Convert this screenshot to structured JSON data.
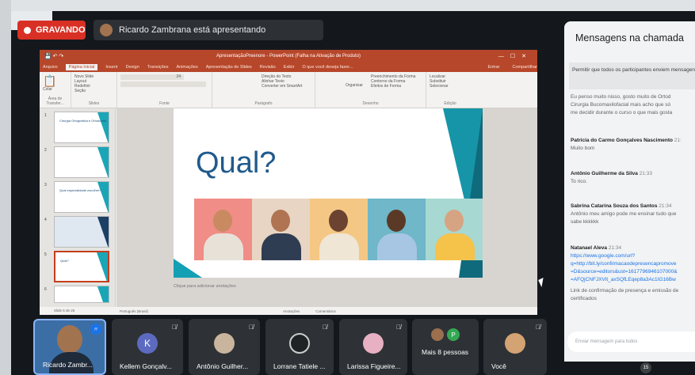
{
  "top_bar": {
    "recording_label": "GRAVANDO",
    "presenter_text": "Ricardo Zambrana está apresentando"
  },
  "powerpoint": {
    "window_title": "ApresentaçãoPreenore - PowerPoint (Falha na Ativação de Produto)",
    "menu_tabs": [
      "Arquivo",
      "Página Inicial",
      "Inserir",
      "Design",
      "Transições",
      "Animações",
      "Apresentação de Slides",
      "Revisão",
      "Exibir"
    ],
    "active_tab": "Página Inicial",
    "tell_me": "O que você deseja fazer...",
    "right_menu": [
      "Entrar",
      "Compartilhar"
    ],
    "ribbon_groups": [
      "Área de Transfer...",
      "Slides",
      "Fonte",
      "Parágrafo",
      "Desenho",
      "Edição"
    ],
    "ribbon_buttons": {
      "paste": "Colar",
      "new_slide": "Novo Slide",
      "layout": "Layout",
      "reset": "Redefinir",
      "section": "Seção",
      "font_size": "24",
      "text_direction": "Direção do Texto",
      "align_text": "Alinhar Texto",
      "smartart": "Converter em SmartArt",
      "arrange": "Organizar",
      "quick_styles": "Estilos Rápidos",
      "shape_fill": "Preenchimento da Forma",
      "shape_outline": "Contorno da Forma",
      "shape_effects": "Efeitos de Forma",
      "find": "Localizar",
      "replace": "Substituir",
      "select": "Selecionar"
    },
    "thumbnails": [
      {
        "num": "1",
        "title": "Cirurgia Ortognática e Ortodontia"
      },
      {
        "num": "2",
        "title": ""
      },
      {
        "num": "3",
        "title": "Qual especialidade escolher?"
      },
      {
        "num": "4",
        "title": ""
      },
      {
        "num": "5",
        "title": "Qual?"
      },
      {
        "num": "6",
        "title": ""
      }
    ],
    "slide": {
      "title": "Qual?",
      "photos": [
        {
          "bg": "#f08d86",
          "skin": "#c98a62",
          "shirt": "#e8e1d8"
        },
        {
          "bg": "#e8d5c3",
          "skin": "#b07452",
          "shirt": "#2f3d52"
        },
        {
          "bg": "#f4c784",
          "skin": "#6b4330",
          "shirt": "#f0e6d6"
        },
        {
          "bg": "#6fb7c9",
          "skin": "#5a3a27",
          "shirt": "#a7c6e3"
        },
        {
          "bg": "#a8d8d2",
          "skin": "#d6a482",
          "shirt": "#f5c24a"
        }
      ]
    },
    "notes_placeholder": "Clique para adicionar anotações",
    "status_left": "Slide 5 de 26",
    "status_lang": "Português (Brasil)",
    "status_notes": "Anotações",
    "status_comments": "Comentários"
  },
  "chat": {
    "title": "Mensagens na chamada",
    "banner": "Permitir que todos os participantes enviem mensagens",
    "messages": [
      {
        "sender": "",
        "time": "",
        "lines": [
          "Eu penso muito nisso, gosto muito de Ortod",
          "Cirurgia Bucomaxilofacial mais acho que só",
          "me decidir durante o curso o que mais gosta"
        ]
      },
      {
        "sender": "Patricia do Carmo Gonçalves Nascimento",
        "time": "21:",
        "lines": [
          "Muito bom"
        ]
      },
      {
        "sender": "Antônio Guilherme da Silva",
        "time": "21:33",
        "lines": [
          "To rico."
        ]
      },
      {
        "sender": "Sabrina Catarina Souza dos Santos",
        "time": "21:34",
        "lines": [
          "Antônio meu amigo pode me ensinar tudo que",
          "sabe kkkkkk"
        ]
      },
      {
        "sender": "Natanael Aleva",
        "time": "21:34",
        "links": [
          "https://www.google.com/url?",
          "q=http://bit.ly/confirmacaodepresencapromove",
          "=D&source=editors&ust=1617796946107000&",
          "=AFQjCNFJXVlt_axSQfLEqep8a3Ac1IG16Bw"
        ],
        "lines": [
          "Link de confirmação de presença e emissão de",
          "certificados"
        ]
      }
    ],
    "input_placeholder": "Enviar mensagem para todos"
  },
  "participants": [
    {
      "name": "Ricardo Zambr...",
      "initial": "",
      "color": "#a1734f"
    },
    {
      "name": "Kellem Gonçalv...",
      "initial": "K",
      "color": "#5c6bc0"
    },
    {
      "name": "Antônio Guilher...",
      "initial": "",
      "color": "#c9b59d"
    },
    {
      "name": "Lorrane Tatiele ...",
      "initial": "",
      "color": "#1f2326"
    },
    {
      "name": "Larissa Figueire...",
      "initial": "",
      "color": "#e8b0c3"
    },
    {
      "name": "Mais 8 pessoas",
      "initial": "P",
      "color": "#34a853"
    },
    {
      "name": "Você",
      "initial": "",
      "color": "#d4a373"
    }
  ],
  "taskbar_badge": "15"
}
